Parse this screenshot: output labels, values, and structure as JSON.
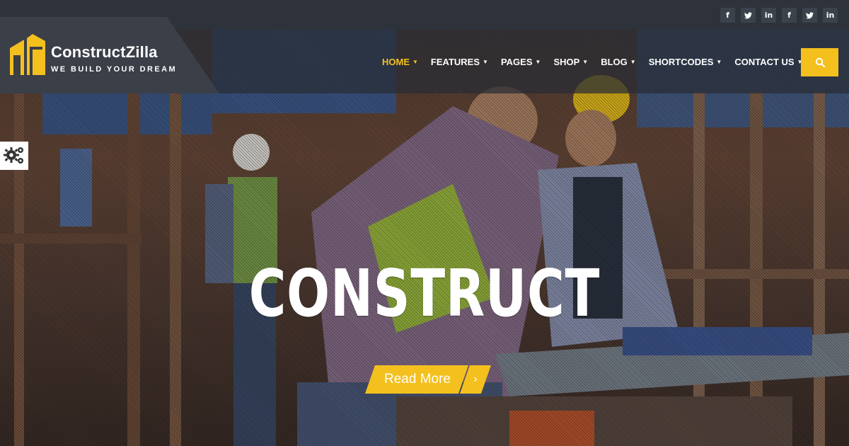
{
  "brand": {
    "name": "ConstructZilla",
    "tagline": "WE BUILD YOUR DREAM"
  },
  "social": [
    {
      "icon": "facebook-icon",
      "glyph": "f"
    },
    {
      "icon": "twitter-icon",
      "glyph": "🐦"
    },
    {
      "icon": "linkedin-icon",
      "glyph": "in"
    },
    {
      "icon": "facebook-icon",
      "glyph": "f"
    },
    {
      "icon": "twitter-icon",
      "glyph": "🐦"
    },
    {
      "icon": "linkedin-icon",
      "glyph": "in"
    }
  ],
  "nav": {
    "items": [
      {
        "label": "HOME",
        "active": true
      },
      {
        "label": "FEATURES"
      },
      {
        "label": "PAGES"
      },
      {
        "label": "SHOP"
      },
      {
        "label": "BLOG"
      },
      {
        "label": "SHORTCODES"
      },
      {
        "label": "CONTACT US"
      }
    ],
    "search_icon": "search-icon"
  },
  "hero": {
    "title": "CONSTRUCT",
    "button_label": "Read More",
    "button_arrow": "›"
  },
  "colors": {
    "accent": "#f4c01e",
    "topbar": "#2e333b",
    "logo_panel": "#3a3f48"
  }
}
